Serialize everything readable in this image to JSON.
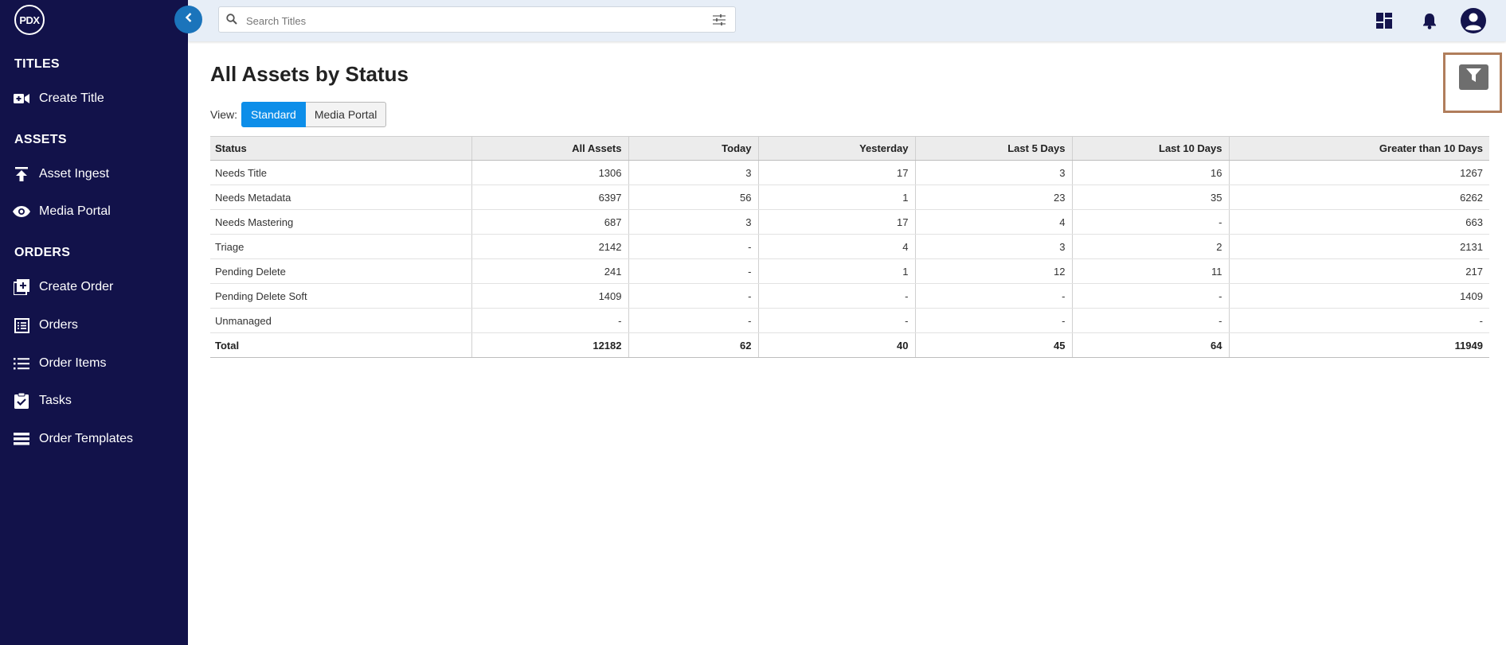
{
  "app": {
    "logo_text": "PDX"
  },
  "sidebar": {
    "sections": [
      {
        "label": "TITLES",
        "items": [
          {
            "label": "Create Title",
            "icon": "video-plus-icon"
          }
        ]
      },
      {
        "label": "ASSETS",
        "items": [
          {
            "label": "Asset Ingest",
            "icon": "upload-icon"
          },
          {
            "label": "Media Portal",
            "icon": "eye-icon"
          }
        ]
      },
      {
        "label": "ORDERS",
        "items": [
          {
            "label": "Create Order",
            "icon": "add-box-icon"
          },
          {
            "label": "Orders",
            "icon": "list-alt-icon"
          },
          {
            "label": "Order Items",
            "icon": "bullet-list-icon"
          },
          {
            "label": "Tasks",
            "icon": "clipboard-check-icon"
          },
          {
            "label": "Order Templates",
            "icon": "table-rows-icon"
          }
        ]
      }
    ]
  },
  "header": {
    "search_placeholder": "Search Titles",
    "icons": [
      "dashboard-icon",
      "bell-icon",
      "account-icon"
    ]
  },
  "page": {
    "title": "All Assets by Status",
    "view_label": "View:",
    "view_options": [
      "Standard",
      "Media Portal"
    ],
    "active_view": "Standard"
  },
  "table": {
    "columns": [
      "Status",
      "All Assets",
      "Today",
      "Yesterday",
      "Last 5 Days",
      "Last 10 Days",
      "Greater than 10 Days"
    ],
    "rows": [
      {
        "status": "Needs Title",
        "cells": [
          "1306",
          "3",
          "17",
          "3",
          "16",
          "1267"
        ]
      },
      {
        "status": "Needs Metadata",
        "cells": [
          "6397",
          "56",
          "1",
          "23",
          "35",
          "6262"
        ]
      },
      {
        "status": "Needs Mastering",
        "cells": [
          "687",
          "3",
          "17",
          "4",
          "-",
          "663"
        ]
      },
      {
        "status": "Triage",
        "cells": [
          "2142",
          "-",
          "4",
          "3",
          "2",
          "2131"
        ]
      },
      {
        "status": "Pending Delete",
        "cells": [
          "241",
          "-",
          "1",
          "12",
          "11",
          "217"
        ]
      },
      {
        "status": "Pending Delete Soft",
        "cells": [
          "1409",
          "-",
          "-",
          "-",
          "-",
          "1409"
        ]
      },
      {
        "status": "Unmanaged",
        "cells": [
          "-",
          "-",
          "-",
          "-",
          "-",
          "-"
        ]
      }
    ],
    "total": {
      "status": "Total",
      "cells": [
        "12182",
        "62",
        "40",
        "45",
        "64",
        "11949"
      ]
    }
  },
  "colors": {
    "sidebar_bg": "#12124a",
    "accent": "#0d8ee9",
    "link": "#2f86c9",
    "topbar_bg": "#e7eef7"
  }
}
